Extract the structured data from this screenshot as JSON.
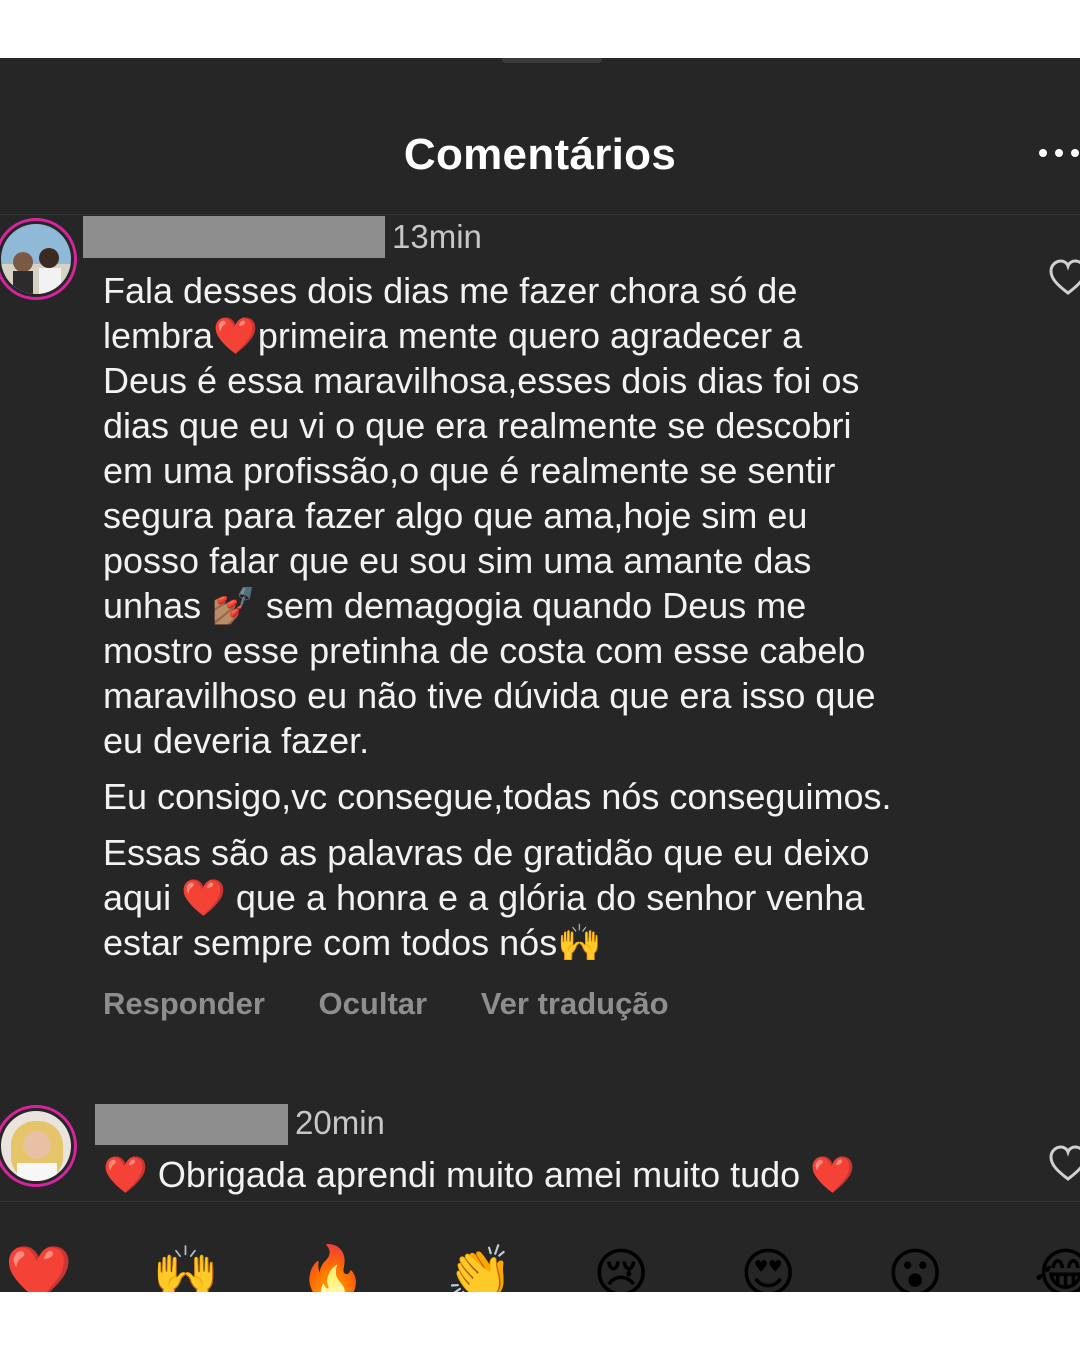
{
  "sheet": {
    "title": "Comentários"
  },
  "comments": [
    {
      "time": "13min",
      "paragraphs": [
        [
          "Fala desses dois dias me fazer chora só de",
          "lembra❤️primeira mente quero agradecer a",
          "Deus é essa maravilhosa,esses dois dias foi os",
          "dias que eu vi o que  era realmente se descobri",
          "em uma profissão,o que é realmente se sentir",
          "segura para fazer algo que ama,hoje sim eu",
          "posso falar que eu sou sim uma amante das",
          "unhas 💅🏽 sem demagogia quando Deus me",
          "mostro esse pretinha de costa com esse cabelo",
          "maravilhoso eu não tive dúvida que era isso que",
          "eu deveria fazer."
        ],
        [
          "Eu consigo,vc consegue,todas nós conseguimos."
        ],
        [
          "Essas são as palavras de gratidão que eu deixo",
          "aqui ❤️ que a honra e a glória do senhor venha",
          "estar sempre com todos nós🙌"
        ]
      ],
      "actions": {
        "reply": "Responder",
        "hide": "Ocultar",
        "translate": "Ver tradução"
      }
    },
    {
      "time": "20min",
      "text": "❤️ Obrigada aprendi muito  amei muito tudo ❤️"
    }
  ],
  "icons": {
    "more": "more-horizontal-icon",
    "like": "heart-outline-icon"
  },
  "quick_reactions": [
    "❤️",
    "🙌",
    "🔥",
    "👏",
    "😢",
    "😍",
    "😮",
    "😂"
  ],
  "colors": {
    "sheet_bg": "#262626",
    "text": "#f2f2f2",
    "secondary": "#8e8e8e",
    "story_ring": "#d6249f"
  }
}
